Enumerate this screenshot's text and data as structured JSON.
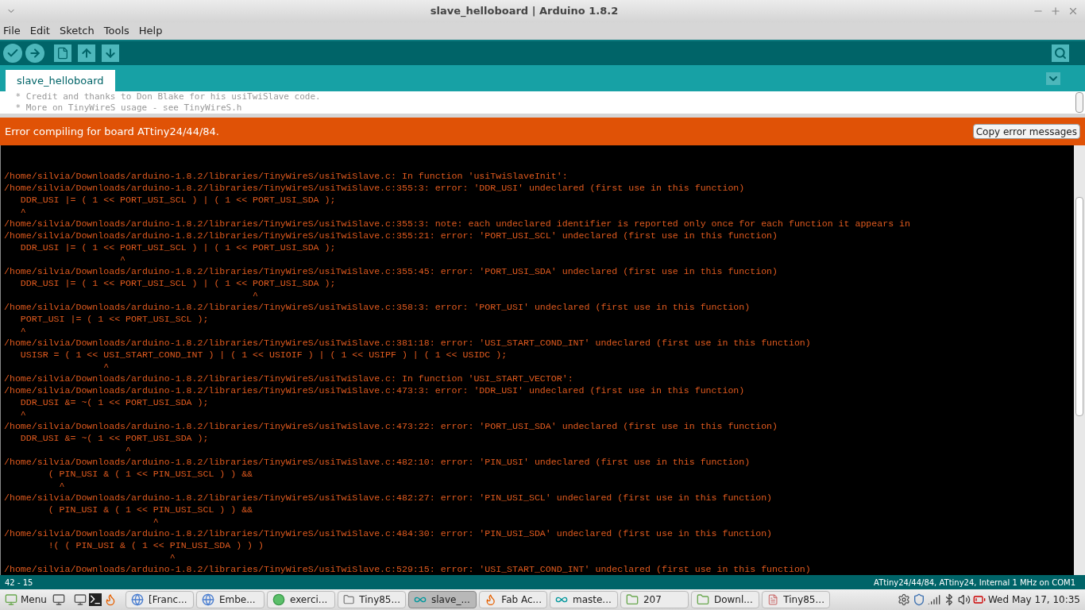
{
  "window": {
    "title": "slave_helloboard | Arduino 1.8.2"
  },
  "menu": [
    "File",
    "Edit",
    "Sketch",
    "Tools",
    "Help"
  ],
  "tabs": [
    {
      "label": "slave_helloboard",
      "selected": true
    }
  ],
  "editor": {
    "lines": [
      " * Credit and thanks to Don Blake for his usiTwiSlave code.",
      " * More on TinyWireS usage - see TinyWireS.h"
    ]
  },
  "error_bar": {
    "message": "Error compiling for board ATtiny24/44/84.",
    "button": "Copy error messages"
  },
  "console": {
    "lines": [
      "/home/silvia/Downloads/arduino-1.8.2/libraries/TinyWireS/usiTwiSlave.c: In function 'usiTwiSlaveInit':",
      "/home/silvia/Downloads/arduino-1.8.2/libraries/TinyWireS/usiTwiSlave.c:355:3: error: 'DDR_USI' undeclared (first use in this function)",
      "   DDR_USI |= ( 1 << PORT_USI_SCL ) | ( 1 << PORT_USI_SDA );",
      "   ^",
      "/home/silvia/Downloads/arduino-1.8.2/libraries/TinyWireS/usiTwiSlave.c:355:3: note: each undeclared identifier is reported only once for each function it appears in",
      "/home/silvia/Downloads/arduino-1.8.2/libraries/TinyWireS/usiTwiSlave.c:355:21: error: 'PORT_USI_SCL' undeclared (first use in this function)",
      "   DDR_USI |= ( 1 << PORT_USI_SCL ) | ( 1 << PORT_USI_SDA );",
      "                     ^",
      "/home/silvia/Downloads/arduino-1.8.2/libraries/TinyWireS/usiTwiSlave.c:355:45: error: 'PORT_USI_SDA' undeclared (first use in this function)",
      "   DDR_USI |= ( 1 << PORT_USI_SCL ) | ( 1 << PORT_USI_SDA );",
      "                                             ^",
      "/home/silvia/Downloads/arduino-1.8.2/libraries/TinyWireS/usiTwiSlave.c:358:3: error: 'PORT_USI' undeclared (first use in this function)",
      "   PORT_USI |= ( 1 << PORT_USI_SCL );",
      "   ^",
      "/home/silvia/Downloads/arduino-1.8.2/libraries/TinyWireS/usiTwiSlave.c:381:18: error: 'USI_START_COND_INT' undeclared (first use in this function)",
      "   USISR = ( 1 << USI_START_COND_INT ) | ( 1 << USIOIF ) | ( 1 << USIPF ) | ( 1 << USIDC );",
      "                  ^",
      "/home/silvia/Downloads/arduino-1.8.2/libraries/TinyWireS/usiTwiSlave.c: In function 'USI_START_VECTOR':",
      "/home/silvia/Downloads/arduino-1.8.2/libraries/TinyWireS/usiTwiSlave.c:473:3: error: 'DDR_USI' undeclared (first use in this function)",
      "   DDR_USI &= ~( 1 << PORT_USI_SDA );",
      "   ^",
      "/home/silvia/Downloads/arduino-1.8.2/libraries/TinyWireS/usiTwiSlave.c:473:22: error: 'PORT_USI_SDA' undeclared (first use in this function)",
      "   DDR_USI &= ~( 1 << PORT_USI_SDA );",
      "                      ^",
      "/home/silvia/Downloads/arduino-1.8.2/libraries/TinyWireS/usiTwiSlave.c:482:10: error: 'PIN_USI' undeclared (first use in this function)",
      "        ( PIN_USI & ( 1 << PIN_USI_SCL ) ) &&",
      "          ^",
      "/home/silvia/Downloads/arduino-1.8.2/libraries/TinyWireS/usiTwiSlave.c:482:27: error: 'PIN_USI_SCL' undeclared (first use in this function)",
      "        ( PIN_USI & ( 1 << PIN_USI_SCL ) ) &&",
      "                           ^",
      "/home/silvia/Downloads/arduino-1.8.2/libraries/TinyWireS/usiTwiSlave.c:484:30: error: 'PIN_USI_SDA' undeclared (first use in this function)",
      "        !( ( PIN_USI & ( 1 << PIN_USI_SDA ) ) )",
      "                              ^",
      "/home/silvia/Downloads/arduino-1.8.2/libraries/TinyWireS/usiTwiSlave.c:529:15: error: 'USI_START_COND_INT' undeclared (first use in this function)"
    ]
  },
  "status_bar": {
    "position": "42 - 15",
    "board": "ATtiny24/44/84, ATtiny24, Internal 1 MHz on COM1"
  },
  "taskbar": {
    "menu": "Menu",
    "tasks": [
      {
        "label": "[Franc...",
        "kind": "browser",
        "selected": false
      },
      {
        "label": "Embe...",
        "kind": "browser",
        "selected": false
      },
      {
        "label": "exerci...",
        "kind": "dot",
        "selected": false
      },
      {
        "label": "Tiny85...",
        "kind": "files",
        "selected": false
      },
      {
        "label": "slave_...",
        "kind": "arduino",
        "selected": true
      },
      {
        "label": "Fab Ac...",
        "kind": "firefox",
        "selected": false
      },
      {
        "label": "maste...",
        "kind": "arduino",
        "selected": false
      },
      {
        "label": "207",
        "kind": "folder",
        "selected": false
      },
      {
        "label": "Downl...",
        "kind": "folder",
        "selected": false
      },
      {
        "label": "Tiny85...",
        "kind": "doc",
        "selected": false
      }
    ],
    "clock": "Wed May 17, 10:35"
  }
}
